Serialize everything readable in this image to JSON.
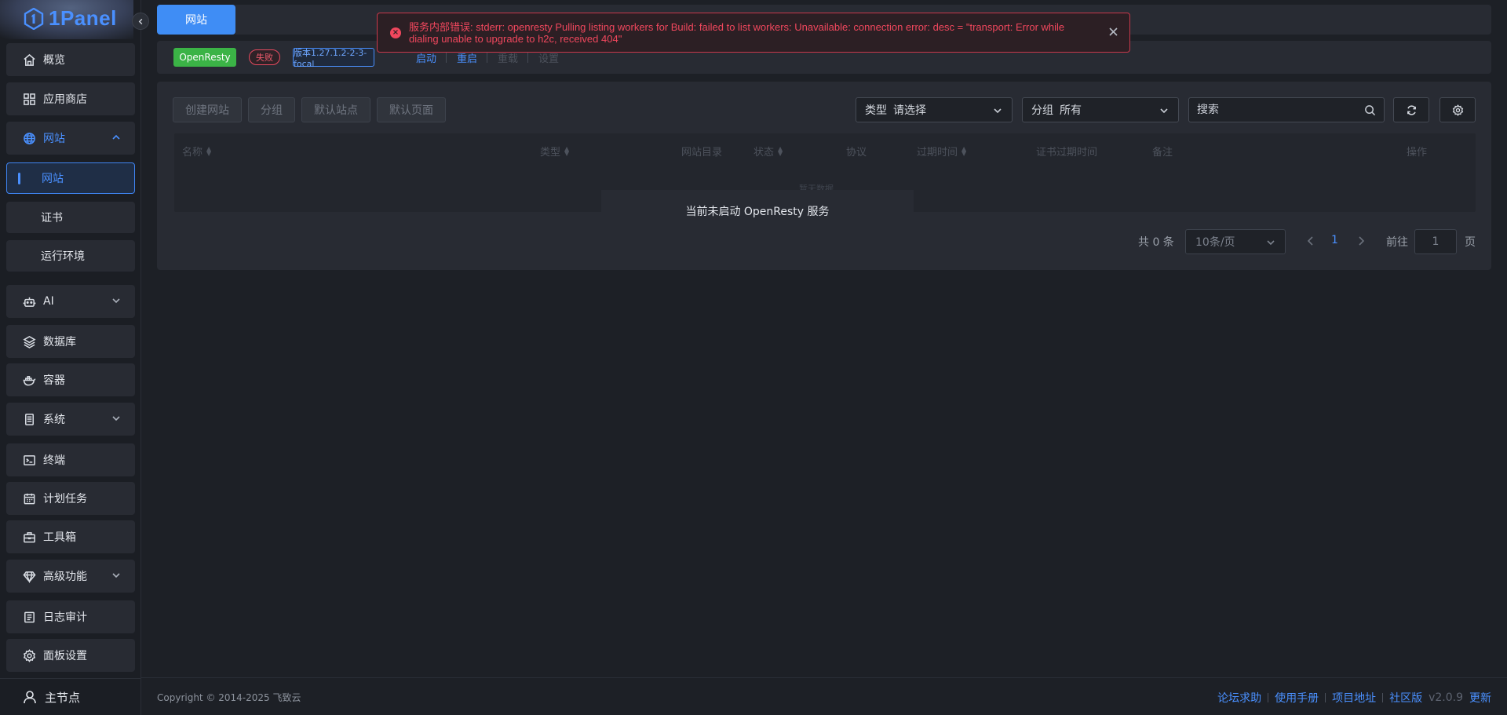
{
  "app": {
    "logo_text": "1Panel"
  },
  "sidebar": {
    "items": [
      {
        "label": "概览",
        "icon": "home-icon"
      },
      {
        "label": "应用商店",
        "icon": "grid-icon"
      },
      {
        "label": "网站",
        "icon": "globe-icon",
        "expanded": true,
        "children": [
          {
            "label": "网站",
            "active": true
          },
          {
            "label": "证书"
          },
          {
            "label": "运行环境"
          }
        ]
      },
      {
        "label": "AI",
        "icon": "robot-icon"
      },
      {
        "label": "数据库",
        "icon": "layers-icon"
      },
      {
        "label": "容器",
        "icon": "docker-icon"
      },
      {
        "label": "系统",
        "icon": "server-icon"
      },
      {
        "label": "终端",
        "icon": "terminal-icon"
      },
      {
        "label": "计划任务",
        "icon": "calendar-icon"
      },
      {
        "label": "工具箱",
        "icon": "toolbox-icon"
      },
      {
        "label": "高级功能",
        "icon": "diamond-icon"
      },
      {
        "label": "日志审计",
        "icon": "log-icon"
      },
      {
        "label": "面板设置",
        "icon": "gear-icon"
      }
    ],
    "footer_node": "主节点"
  },
  "tabs": {
    "active_label": "网站"
  },
  "status": {
    "app_name": "OpenResty",
    "state": "失败",
    "version": "版本1.27.1.2-2-3-focal",
    "ops": [
      "启动",
      "重启",
      "重载",
      "设置"
    ]
  },
  "toolbar": {
    "create_site": "创建网站",
    "group": "分组",
    "default_site": "默认站点",
    "default_page": "默认页面",
    "type_label": "类型",
    "type_value": "请选择",
    "group_label": "分组",
    "group_value": "所有",
    "search_placeholder": "搜索"
  },
  "table": {
    "columns": [
      "名称",
      "类型",
      "网站目录",
      "状态",
      "协议",
      "过期时间",
      "证书过期时间",
      "备注",
      "操作"
    ],
    "empty_text": "暂无数据",
    "mask_text": "当前未启动 OpenResty 服务"
  },
  "pagination": {
    "total_text": "共 0 条",
    "page_size": "10条/页",
    "current_page": "1",
    "goto_label": "前往",
    "goto_value": "1",
    "page_suffix": "页"
  },
  "toast": {
    "type": "error",
    "message": "服务内部错误: stderr: openresty Pulling listing workers for Build: failed to list workers: Unavailable: connection error: desc = \"transport: Error while dialing unable to upgrade to h2c, received 404\""
  },
  "footer": {
    "copyright": "Copyright © 2014-2025 飞致云",
    "links": [
      "论坛求助",
      "使用手册",
      "项目地址",
      "社区版"
    ],
    "version": "v2.0.9",
    "update": "更新"
  },
  "colors": {
    "accent": "#4a90ff",
    "success": "#3bb346",
    "danger": "#f0475d"
  }
}
